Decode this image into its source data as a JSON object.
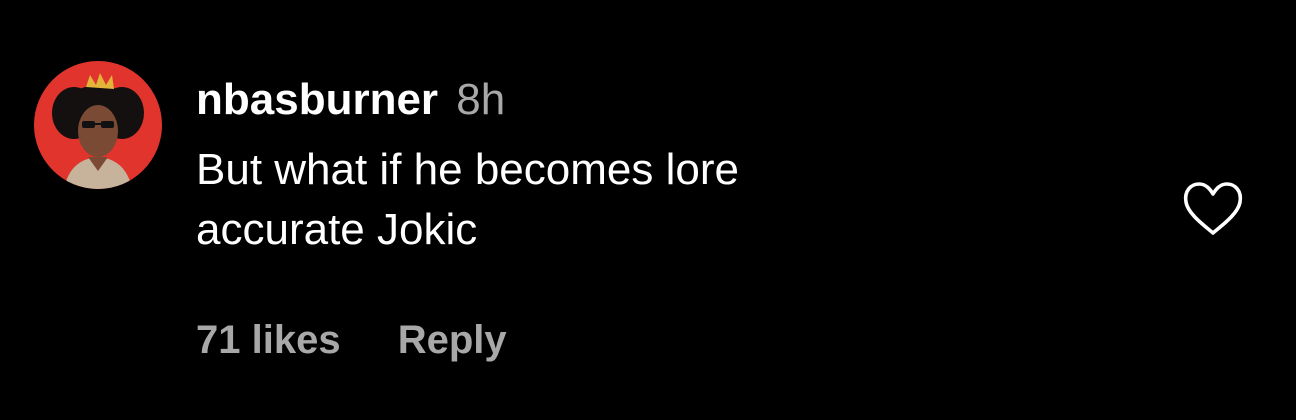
{
  "comment": {
    "username": "nbasburner",
    "timestamp": "8h",
    "text_line1": "But what if he becomes lore",
    "text_line2": "accurate Jokic",
    "likes": "71 likes",
    "reply_label": "Reply",
    "like_icon": "heart-icon"
  },
  "colors": {
    "background": "#000000",
    "text": "#ffffff",
    "secondary": "#a8a8a8",
    "avatar_bg": "#e0342d"
  }
}
